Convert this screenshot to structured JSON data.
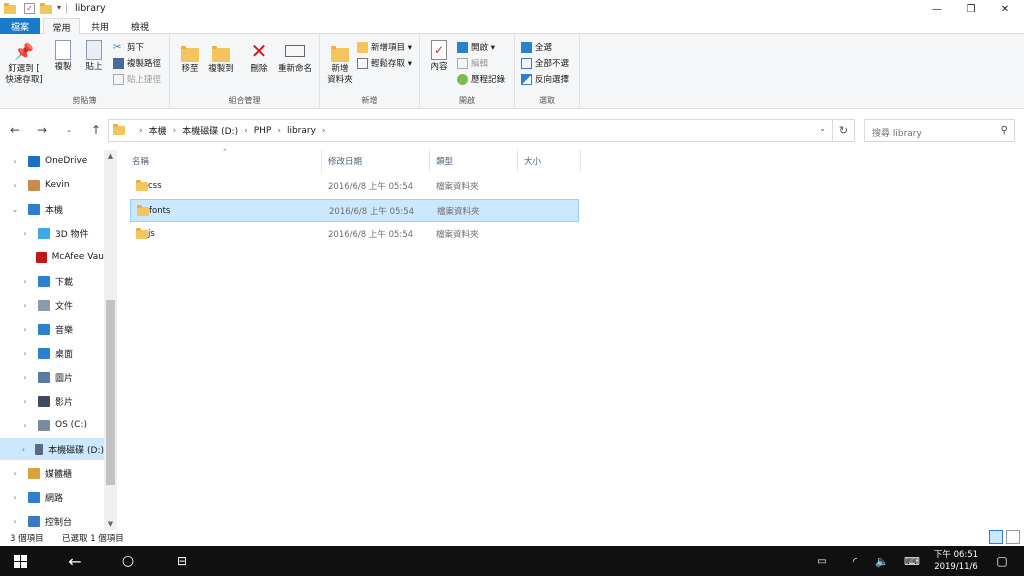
{
  "window": {
    "title": "library",
    "controls": {
      "minimize": "—",
      "maximize": "❐",
      "close": "✕"
    }
  },
  "ribbon_tabs": [
    "檔案",
    "常用",
    "共用",
    "檢視"
  ],
  "ribbon": {
    "clipboard": {
      "label": "剪貼簿",
      "pin": "釘選到 [\n快速存取]",
      "copy": "複製",
      "paste": "貼上",
      "cut": "剪下",
      "copy_path": "複製路徑",
      "paste_shortcut": "貼上捷徑"
    },
    "organize": {
      "label": "組合管理",
      "move_to": "移至",
      "copy_to": "複製到",
      "delete": "刪除",
      "rename": "重新命名"
    },
    "new": {
      "label": "新增",
      "new_folder": "新增\n資料夾",
      "new_item": "新增項目 ▾",
      "easy_access": "輕鬆存取 ▾"
    },
    "open": {
      "label": "開啟",
      "properties": "內容",
      "open": "開啟 ▾",
      "edit": "編輯",
      "history": "歷程記錄"
    },
    "select": {
      "label": "選取",
      "select_all": "全選",
      "select_none": "全部不選",
      "invert": "反向選擇"
    }
  },
  "address": {
    "crumbs": [
      "本機",
      "本機磁碟 (D:)",
      "PHP",
      "library"
    ],
    "search_placeholder": "搜尋 library"
  },
  "nav_pane": [
    {
      "label": "OneDrive",
      "icon": "cloud-icon",
      "color": "#1b6fc4",
      "chev": ">"
    },
    {
      "label": "Kevin",
      "icon": "user-icon",
      "color": "#c98a52",
      "chev": ">"
    },
    {
      "label": "本機",
      "icon": "computer-icon",
      "color": "#2d7fd0",
      "chev": "v"
    },
    {
      "label": "3D 物件",
      "icon": "3d-objects-icon",
      "color": "#3fa6e8",
      "chev": ">"
    },
    {
      "label": "McAfee Vau",
      "icon": "mcafee-icon",
      "color": "#c01818",
      "chev": ""
    },
    {
      "label": "下載",
      "icon": "download-icon",
      "color": "#2d7fd0",
      "chev": ">"
    },
    {
      "label": "文件",
      "icon": "documents-icon",
      "color": "#8a9bb0",
      "chev": ">"
    },
    {
      "label": "音樂",
      "icon": "music-icon",
      "color": "#2d7fd0",
      "chev": ">"
    },
    {
      "label": "桌面",
      "icon": "desktop-icon",
      "color": "#2d7fd0",
      "chev": ">"
    },
    {
      "label": "圖片",
      "icon": "pictures-icon",
      "color": "#5a7aa0",
      "chev": ">"
    },
    {
      "label": "影片",
      "icon": "videos-icon",
      "color": "#404a5a",
      "chev": ">"
    },
    {
      "label": "OS (C:)",
      "icon": "drive-icon",
      "color": "#7a8a9a",
      "chev": ">"
    },
    {
      "label": "本機磁碟 (D:)",
      "icon": "drive-icon",
      "color": "#5a6a7a",
      "chev": ">"
    },
    {
      "label": "媒體櫃",
      "icon": "library-icon",
      "color": "#d9a23a",
      "chev": ">"
    },
    {
      "label": "網路",
      "icon": "network-icon",
      "color": "#2d7fd0",
      "chev": ">"
    },
    {
      "label": "控制台",
      "icon": "control-panel-icon",
      "color": "#3a7ac0",
      "chev": ">"
    }
  ],
  "columns": [
    "名稱",
    "修改日期",
    "類型",
    "大小"
  ],
  "files": [
    {
      "name": "css",
      "modified": "2016/6/8 上午 05:54",
      "type": "檔案資料夾",
      "size": ""
    },
    {
      "name": "fonts",
      "modified": "2016/6/8 上午 05:54",
      "type": "檔案資料夾",
      "size": ""
    },
    {
      "name": "js",
      "modified": "2016/6/8 上午 05:54",
      "type": "檔案資料夾",
      "size": ""
    }
  ],
  "status": {
    "count": "3 個項目",
    "selected": "已選取 1 個項目"
  },
  "taskbar": {
    "time": "下午 06:51",
    "date": "2019/11/6"
  },
  "colors": {
    "accent": "#1979ca",
    "selection": "#cce8ff",
    "folder": "#f3c55c"
  }
}
